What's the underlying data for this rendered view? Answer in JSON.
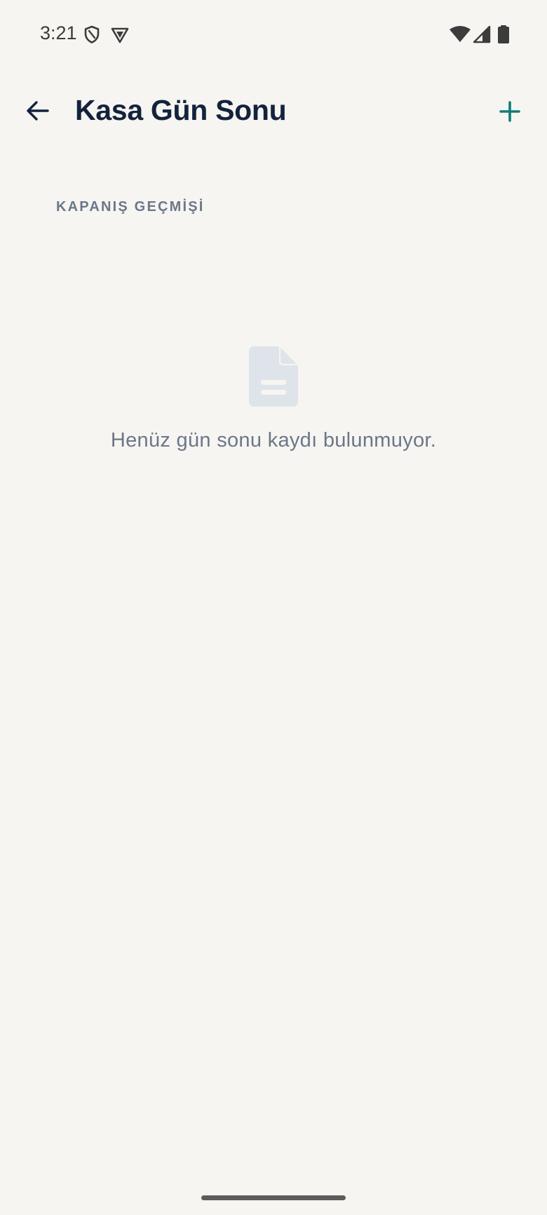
{
  "status_bar": {
    "time": "3:21",
    "left_icons": [
      "shield-icon",
      "vpn-badge-icon"
    ],
    "right_icons": [
      "wifi-icon",
      "cellular-signal-icon",
      "battery-icon"
    ]
  },
  "app_bar": {
    "title": "Kasa Gün Sonu",
    "back_icon": "arrow-left-icon",
    "add_icon": "plus-icon"
  },
  "section": {
    "header": "KAPANIŞ GEÇMİŞİ"
  },
  "empty_state": {
    "icon": "document-icon",
    "message": "Henüz gün sonu kaydı bulunmuyor."
  },
  "colors": {
    "background": "#f7f5f1",
    "title": "#13233d",
    "accent": "#0f7c77",
    "muted": "#6b7789",
    "empty_icon": "#dfe4ea"
  }
}
